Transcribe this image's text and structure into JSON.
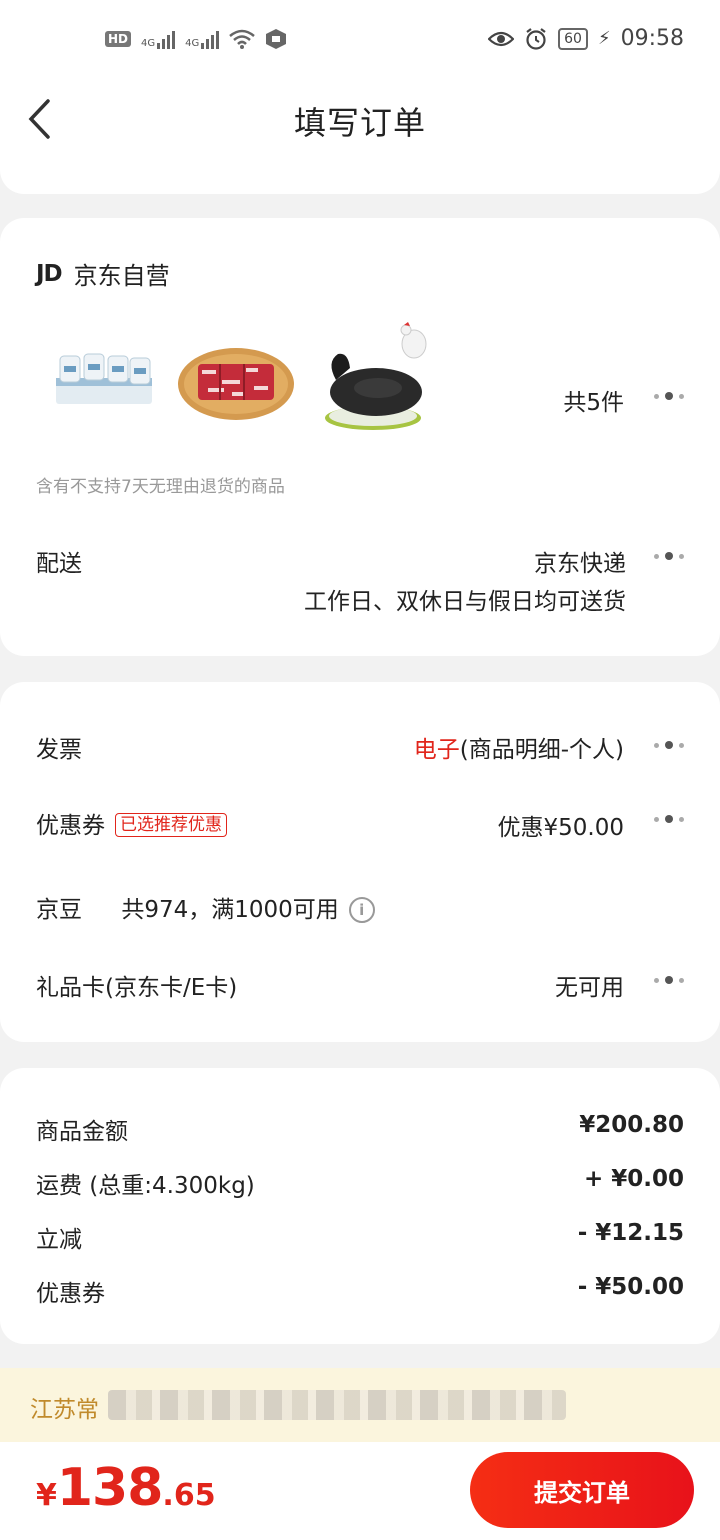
{
  "status_bar": {
    "hd": "HD",
    "net1": "4G",
    "net2": "4G",
    "battery": "60",
    "time": "09:58"
  },
  "header": {
    "back_icon": "chevron-left-icon",
    "title": "填写订单"
  },
  "shop_card": {
    "brand_logo": "JD",
    "shop_name": "京东自营",
    "product_icons": [
      "yogurt-cups",
      "beef-slices",
      "black-chicken"
    ],
    "item_count": "共5件",
    "return_note": "含有不支持7天无理由退货的商品",
    "delivery_label": "配送",
    "delivery_method": "京东快递",
    "delivery_time": "工作日、双休日与假日均可送货"
  },
  "options_card": {
    "invoice_label": "发票",
    "invoice_type": "电子",
    "invoice_detail": "(商品明细-个人)",
    "coupon_label": "优惠券",
    "coupon_badge": "已选推荐优惠",
    "coupon_value": "优惠¥50.00",
    "jingdou_label": "京豆",
    "jingdou_text": "共974，满1000可用",
    "giftcard_label": "礼品卡(京东卡/E卡)",
    "giftcard_value": "无可用"
  },
  "summary_card": {
    "rows": [
      {
        "label": "商品金额",
        "value": "¥200.80"
      },
      {
        "label": "运费 (总重:4.300kg)",
        "value": "+ ¥0.00"
      },
      {
        "label": "立减",
        "value": "- ¥12.15"
      },
      {
        "label": "优惠券",
        "value": "- ¥50.00"
      }
    ]
  },
  "address_bar": {
    "text": "江苏常"
  },
  "bottom_bar": {
    "currency": "¥",
    "total_int": "138",
    "total_dec": ".65",
    "submit_label": "提交订单"
  },
  "colors": {
    "accent_red": "#e1251b",
    "address_bg": "#fbf5dd",
    "address_text": "#c08a2b"
  }
}
